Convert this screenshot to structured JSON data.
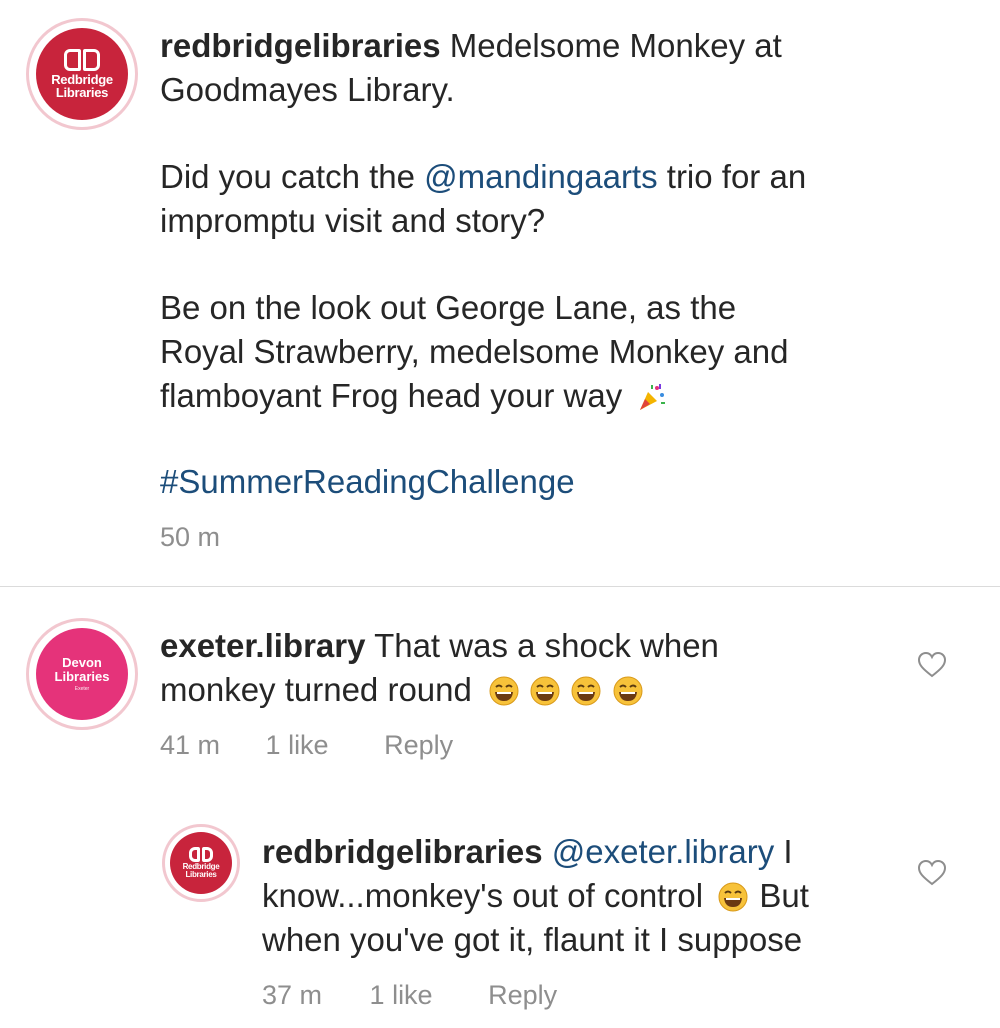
{
  "post": {
    "avatar_text": [
      "Redbridge",
      "Libraries"
    ],
    "username": "redbridgelibraries",
    "line1": "Medelsome Monkey at",
    "line2": "Goodmayes Library.",
    "line3_pre": "Did you catch the ",
    "mention": "@mandingaarts",
    "line3_post": " trio for an",
    "line4": "impromptu visit and story?",
    "line5": "Be on the look out George Lane, as the",
    "line6": "Royal Strawberry, medelsome Monkey and",
    "line7": "flamboyant Frog head your way",
    "line7_emoji_icon": "party-popper-icon",
    "hashtag": "#SummerReadingChallenge",
    "time": "50 m"
  },
  "comments": [
    {
      "avatar_text": [
        "Devon",
        "Libraries",
        "Exeter"
      ],
      "username": "exeter.library",
      "line1": "That was a shock when",
      "line2": "monkey turned round",
      "emoji_icon": "laughing-face-icon",
      "time": "41 m",
      "likes": "1 like",
      "reply": "Reply",
      "like_icon": "heart-outline-icon"
    },
    {
      "avatar_text": [
        "Redbridge",
        "Libraries"
      ],
      "username": "redbridgelibraries",
      "mention": "@exeter.library",
      "line1_post": " I",
      "line2_pre": "know...monkey's out of control",
      "line2_post": " But",
      "line3": "when you've got it, flaunt it I suppose",
      "emoji_icon": "laughing-face-icon",
      "time": "37 m",
      "likes": "1 like",
      "reply": "Reply",
      "like_icon": "heart-outline-icon"
    }
  ],
  "colors": {
    "link": "#1c4d7a",
    "meta": "#8e8e8e",
    "redbridge_brand": "#c8243c",
    "devon_brand": "#e5337a"
  }
}
